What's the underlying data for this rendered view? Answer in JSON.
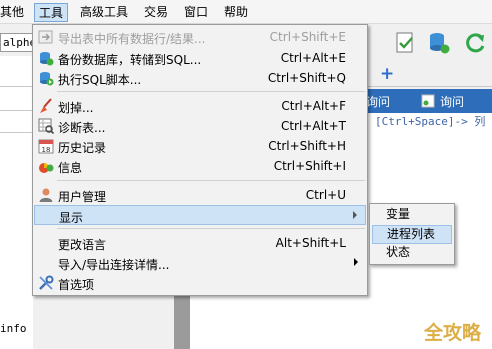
{
  "menubar": {
    "items": [
      {
        "label": "其他"
      },
      {
        "label": "工具"
      },
      {
        "label": "高级工具"
      },
      {
        "label": "交易"
      },
      {
        "label": "窗口"
      },
      {
        "label": "帮助"
      }
    ]
  },
  "background": {
    "left_input_value": "alphe",
    "left_text": "info",
    "blue_bar_items": [
      "询问",
      "询问"
    ],
    "hint_text": "，[Ctrl+Space]-> 列"
  },
  "tools_menu": {
    "items": [
      {
        "label": "导出表中所有数据行/结果...",
        "shortcut": "Ctrl+Shift+E",
        "icon": "export-icon",
        "disabled": true
      },
      {
        "label": "备份数据库，转储到SQL...",
        "shortcut": "Ctrl+Alt+E",
        "icon": "database-backup-icon"
      },
      {
        "label": "执行SQL脚本...",
        "shortcut": "Ctrl+Shift+Q",
        "icon": "execute-sql-icon"
      },
      {
        "label": "划掉...",
        "shortcut": "Ctrl+Alt+F",
        "icon": "broom-icon"
      },
      {
        "label": "诊断表...",
        "shortcut": "Ctrl+Alt+T",
        "icon": "diagnose-table-icon"
      },
      {
        "label": "历史记录",
        "shortcut": "Ctrl+Shift+H",
        "icon": "calendar-icon"
      },
      {
        "label": "信息",
        "shortcut": "Ctrl+Shift+I",
        "icon": "info-pie-icon"
      },
      {
        "label": "用户管理",
        "shortcut": "Ctrl+U",
        "icon": "user-icon"
      },
      {
        "label": "显示",
        "shortcut": "",
        "icon": "",
        "submenu": true
      },
      {
        "label": "更改语言",
        "shortcut": "Alt+Shift+L",
        "icon": ""
      },
      {
        "label": "导入/导出连接详情...",
        "shortcut": "",
        "icon": "",
        "submenu": true
      },
      {
        "label": "首选项",
        "shortcut": "",
        "icon": "preferences-icon"
      }
    ]
  },
  "display_submenu": {
    "items": [
      "变量",
      "进程列表",
      "状态"
    ],
    "highlighted": "进程列表"
  },
  "watermark": "全攻略",
  "colors": {
    "highlight": "#cfe3f7",
    "blue_bar": "#2e6db9",
    "watermark": "#d8a126"
  }
}
